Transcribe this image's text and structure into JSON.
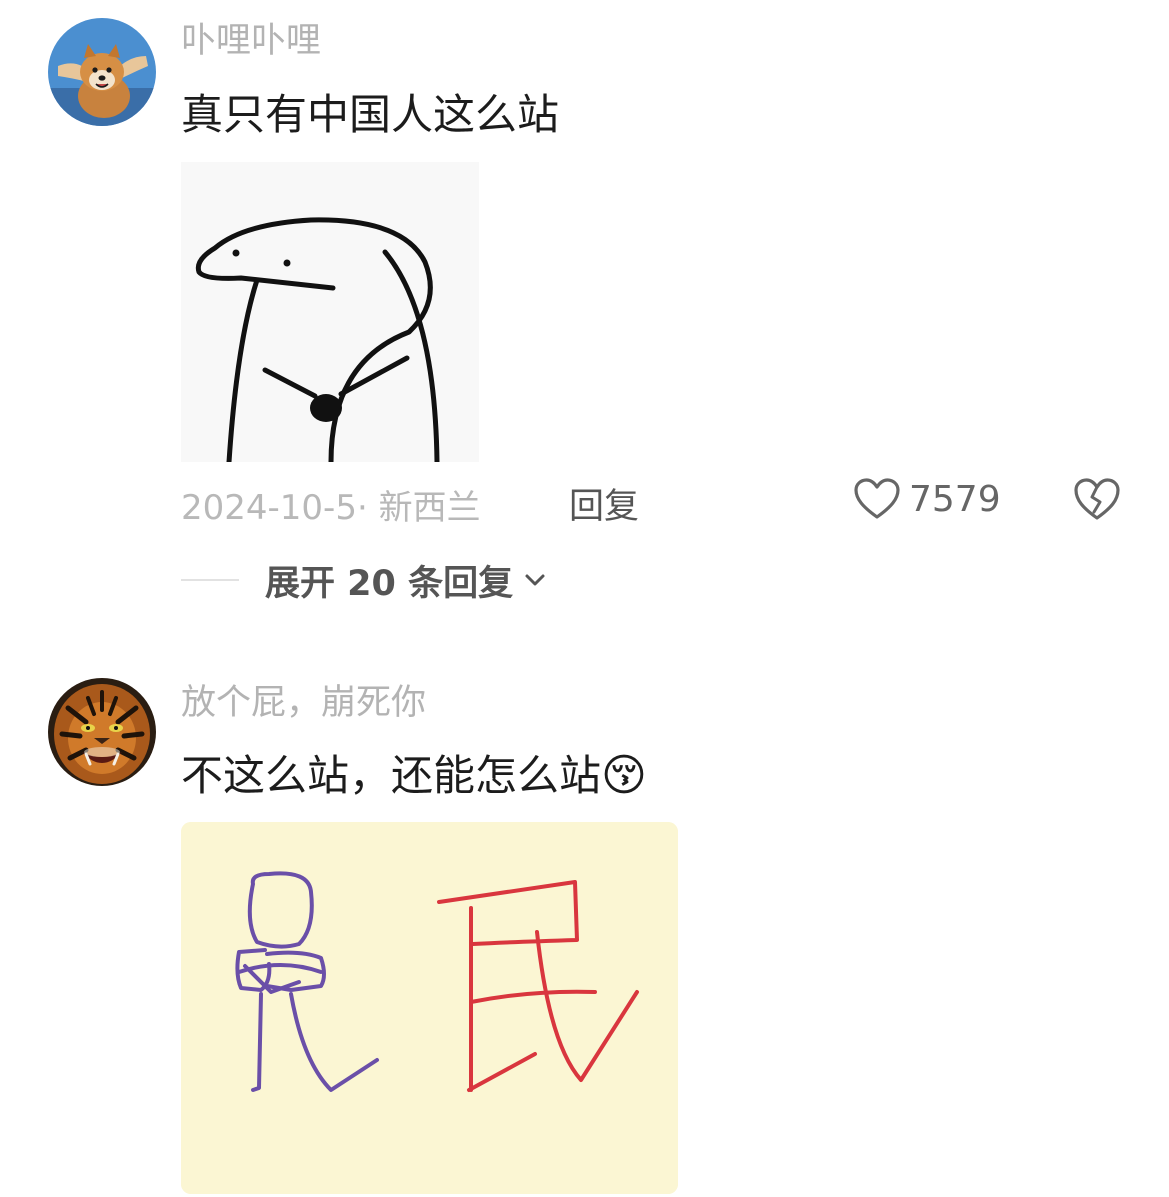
{
  "comments": [
    {
      "username": "卟哩卟哩",
      "text": "真只有中国人这么站",
      "avatar_icon": "shiba-dog-avatar",
      "image_icon": "stick-figure-meme",
      "date_location": "2024-10-5· 新西兰",
      "reply_label": "回复",
      "like_count": "7579",
      "expand_label": "展开 20 条回复"
    },
    {
      "username": "放个屁，崩死你",
      "text": "不这么站，还能怎么站",
      "emoji": "😚",
      "avatar_icon": "tiger-avatar",
      "image_icon": "drawing-stick-figure-and-character",
      "drawing_text": "民"
    }
  ],
  "colors": {
    "username": "#b3b3b3",
    "meta": "#b8b8b8",
    "action": "#555555",
    "drawing_purple": "#6a4fa8",
    "drawing_red": "#d9363e",
    "drawing_bg": "#fbf6d3"
  }
}
